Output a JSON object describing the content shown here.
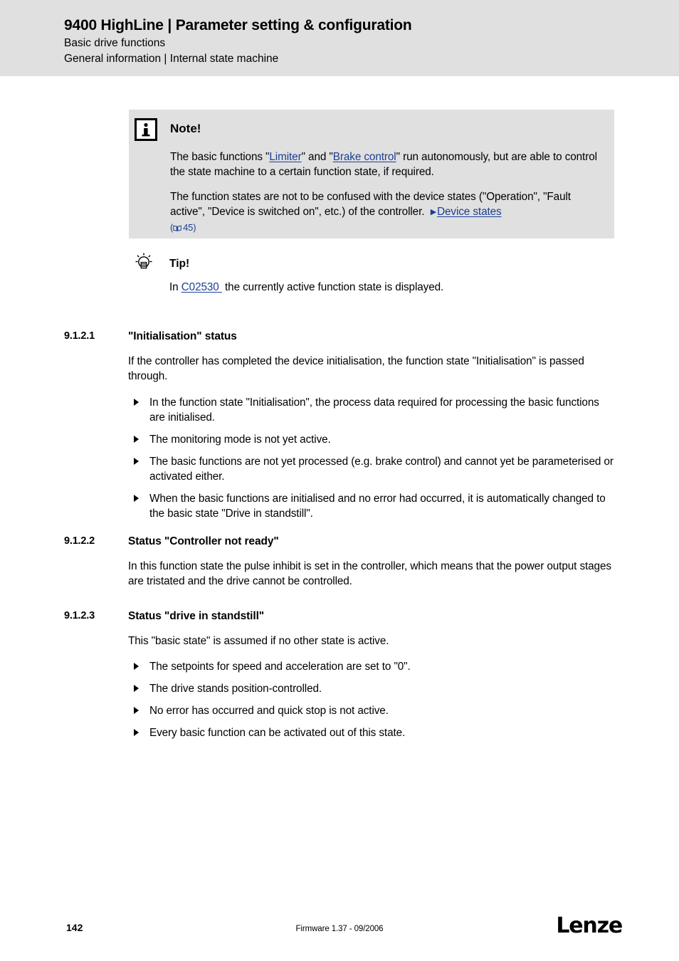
{
  "header": {
    "title": "9400 HighLine | Parameter setting & configuration",
    "subtitle1": "Basic drive functions",
    "subtitle2": "General information | Internal state machine"
  },
  "note": {
    "icon": "info-icon",
    "title": "Note!",
    "paragraph1_part1": "The basic functions \"",
    "link_limiter": "Limiter",
    "paragraph1_part2": "\" and \"",
    "link_brake_control": "Brake control",
    "paragraph1_part3": "\" run autonomously, but are able to control the state machine to a certain function state, if required.",
    "paragraph2_part1": "The function states are not to be confused with the device states (\"Operation\", \"Fault active\", \"Device is switched on\", etc.) of the controller.",
    "link_device_states": "Device states",
    "page_ref": "45",
    "bg_color": "#e0e0e0",
    "link_color": "#1b3f94"
  },
  "tip": {
    "icon": "lightbulb-icon",
    "title": "Tip!",
    "text_before": "In",
    "link_code": "C02530",
    "text_after": "the currently active function state is displayed."
  },
  "sections": [
    {
      "number": "9.1.2.1",
      "heading": "\"Initialisation\" status",
      "paragraph": "If the controller has completed the device initialisation, the function state \"Initialisation\" is passed through.",
      "bullets": [
        "In the function state \"Initialisation\", the process data required for processing the basic functions are initialised.",
        "The monitoring mode is not yet active.",
        "The basic functions are not yet processed (e.g. brake control) and cannot yet be parameterised or activated either.",
        "When the basic functions are initialised and no error had occurred, it is automatically changed to the basic state \"Drive in standstill\"."
      ]
    },
    {
      "number": "9.1.2.2",
      "heading": "Status \"Controller not ready\"",
      "paragraph": "In this function state the pulse inhibit is set in the controller, which means that the power output stages are tristated and the drive cannot be controlled.",
      "bullets": []
    },
    {
      "number": "9.1.2.3",
      "heading": "Status \"drive in standstill\"",
      "paragraph": "This \"basic state\" is assumed if no other state is active.",
      "bullets": [
        "The setpoints for speed and acceleration are set to \"0\".",
        "The drive stands position-controlled.",
        "No error has occurred and quick stop is not active.",
        "Every basic function can be activated out of this state."
      ]
    }
  ],
  "footer": {
    "page_number": "142",
    "firmware": "Firmware 1.37 - 09/2006",
    "logo": "Lenze"
  }
}
